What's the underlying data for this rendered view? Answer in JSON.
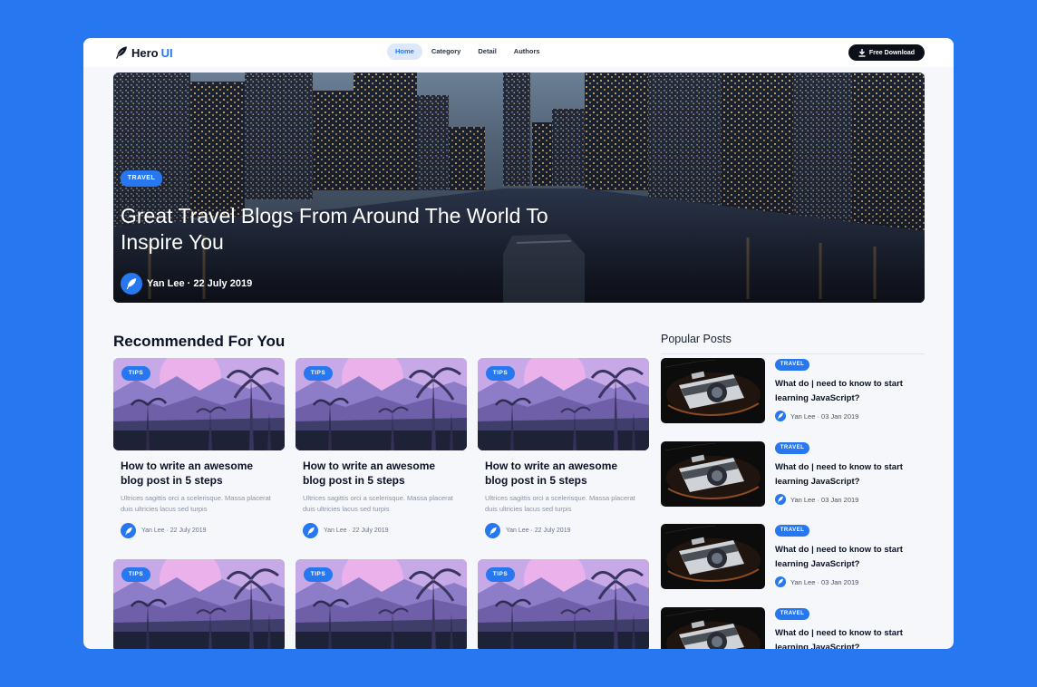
{
  "brand": {
    "name": "Hero",
    "accent": "UI",
    "accent_color": "#2677f0",
    "icon": "feather-icon"
  },
  "nav": {
    "items": [
      {
        "label": "Home",
        "active": true
      },
      {
        "label": "Category",
        "active": false
      },
      {
        "label": "Detail",
        "active": false
      },
      {
        "label": "Authors",
        "active": false
      }
    ],
    "download_label": "Free Download",
    "download_icon": "download-icon"
  },
  "hero": {
    "tag": "TRAVEL",
    "title": "Great Travel Blogs From Around The World To Inspire You",
    "byline": "Yan Lee · 22 July 2019"
  },
  "recommended": {
    "title": "Recommended For You",
    "cards": [
      {
        "tag": "TIPS",
        "title": "How to write an awesome blog post in 5 steps",
        "desc": "Ultrices sagittis orci a scelerisque. Massa placerat duis ultricies lacus sed turpis",
        "byline": "Yan Lee · 22 July 2019"
      },
      {
        "tag": "TIPS",
        "title": "How to write an awesome blog post in 5 steps",
        "desc": "Ultrices sagittis orci a scelerisque. Massa placerat duis ultricies lacus sed turpis",
        "byline": "Yan Lee · 22 July 2019"
      },
      {
        "tag": "TIPS",
        "title": "How to write an awesome blog post in 5 steps",
        "desc": "Ultrices sagittis orci a scelerisque. Massa placerat duis ultricies lacus sed turpis",
        "byline": "Yan Lee · 22 July 2019"
      },
      {
        "tag": "TIPS"
      },
      {
        "tag": "TIPS"
      },
      {
        "tag": "TIPS"
      }
    ]
  },
  "popular": {
    "title": "Popular Posts",
    "posts": [
      {
        "tag": "TRAVEL",
        "title": "What do | need to know to start learning JavaScript?",
        "byline": "Yan Lee · 03 Jan 2019"
      },
      {
        "tag": "TRAVEL",
        "title": "What do | need to know to start learning JavaScript?",
        "byline": "Yan Lee · 03 Jan 2019"
      },
      {
        "tag": "TRAVEL",
        "title": "What do | need to know to start learning JavaScript?",
        "byline": "Yan Lee · 03 Jan 2019"
      },
      {
        "tag": "TRAVEL",
        "title": "What do | need to know to start learning JavaScript?"
      }
    ]
  },
  "colors": {
    "page_bg": "#2677f0",
    "accent": "#2677f0",
    "content_bg": "#f5f7fb",
    "dark_button": "#0b0f18"
  }
}
